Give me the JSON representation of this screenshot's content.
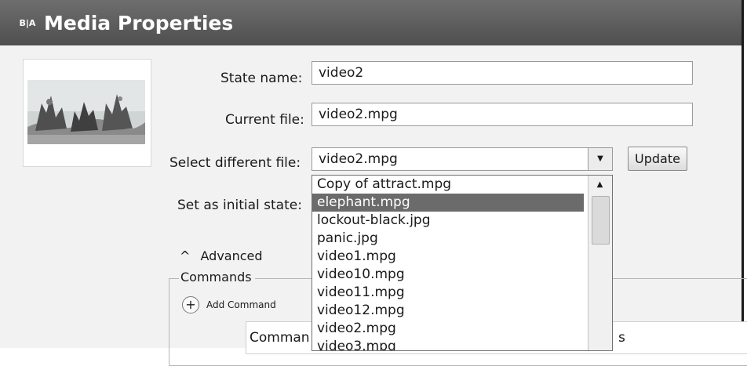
{
  "window": {
    "title": "Media Properties",
    "icon_text": "B|A",
    "icon_name": "app-logo-icon"
  },
  "form": {
    "state_name_label": "State name:",
    "state_name_value": "video2",
    "current_file_label": "Current file:",
    "current_file_value": "video2.mpg",
    "select_file_label": "Select different file:",
    "select_file_value": "video2.mpg",
    "update_label": "Update",
    "initial_state_label": "Set as initial state:"
  },
  "dropdown": {
    "items": [
      "Copy of attract.mpg",
      "elephant.mpg",
      "lockout-black.jpg",
      "panic.jpg",
      "video1.mpg",
      "video10.mpg",
      "video11.mpg",
      "video12.mpg",
      "video2.mpg",
      "video3.mpg"
    ],
    "highlighted": "elephant.mpg"
  },
  "advanced": {
    "label": "Advanced",
    "commands_legend": "Commands",
    "add_command_label": "Add Command",
    "table_col1": "Comman",
    "table_col2_tail": "s"
  }
}
